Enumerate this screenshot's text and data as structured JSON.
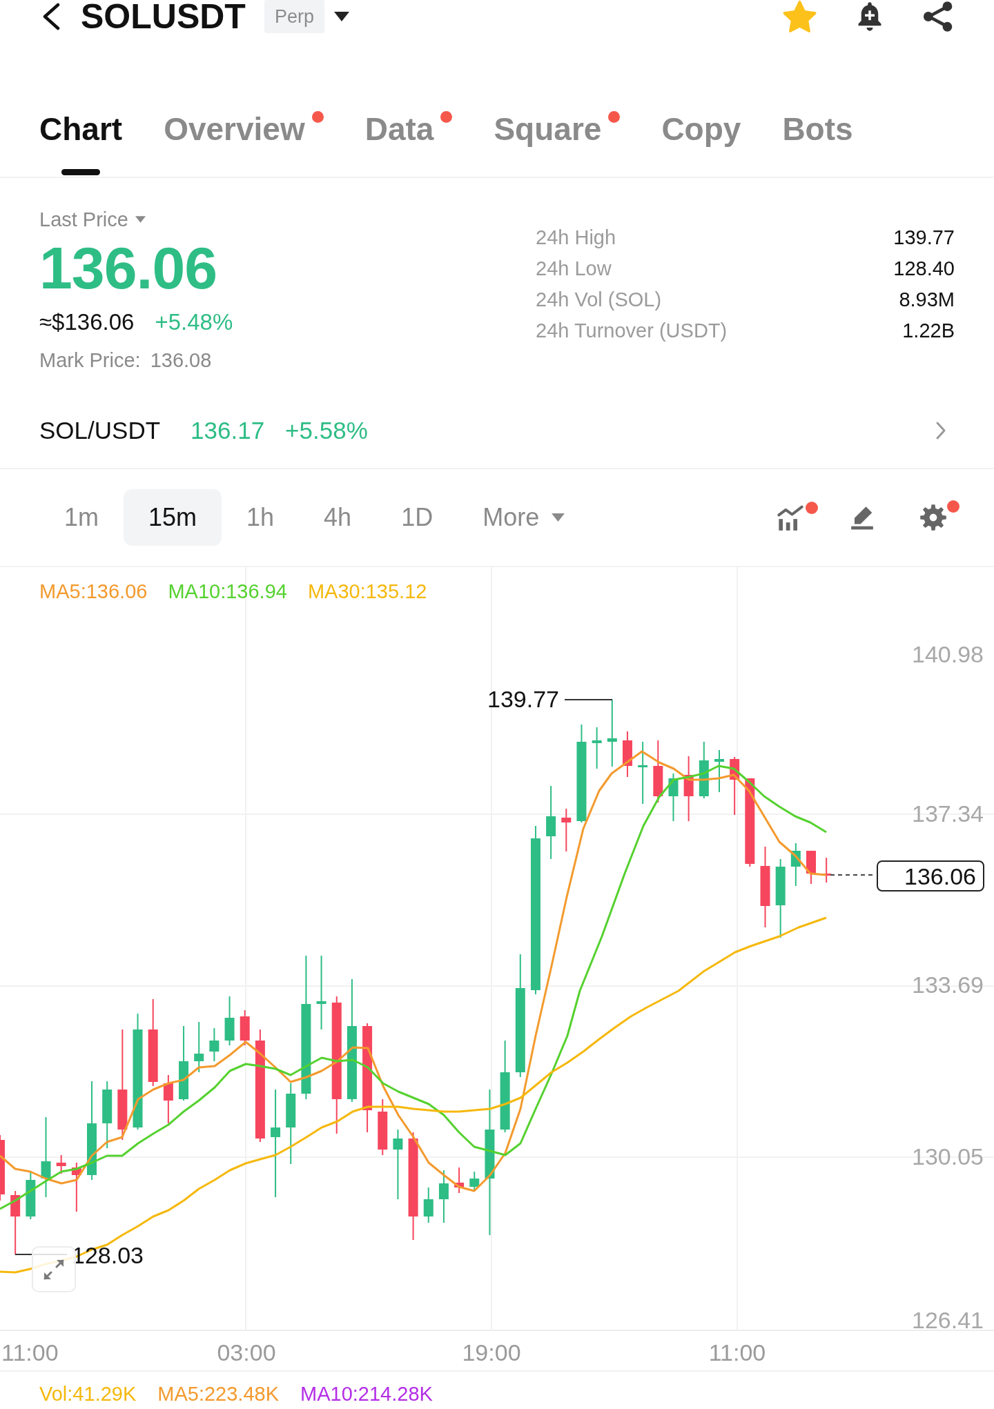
{
  "header": {
    "title": "SOLUSDT",
    "badge": "Perp",
    "favorite": true
  },
  "tabs": [
    {
      "label": "Chart",
      "selected": true,
      "dot": false
    },
    {
      "label": "Overview",
      "selected": false,
      "dot": true
    },
    {
      "label": "Data",
      "selected": false,
      "dot": true
    },
    {
      "label": "Square",
      "selected": false,
      "dot": true
    },
    {
      "label": "Copy",
      "selected": false,
      "dot": false
    },
    {
      "label": "Bots",
      "selected": false,
      "dot": false
    }
  ],
  "price": {
    "label": "Last Price",
    "last": "136.06",
    "usd": "≈$136.06",
    "change": "+5.48%",
    "mark_label": "Mark Price:",
    "mark_value": "136.08"
  },
  "stats": [
    {
      "label": "24h High",
      "value": "139.77"
    },
    {
      "label": "24h Low",
      "value": "128.40"
    },
    {
      "label": "24h Vol (SOL)",
      "value": "8.93M"
    },
    {
      "label": "24h Turnover (USDT)",
      "value": "1.22B"
    }
  ],
  "spot": {
    "pair": "SOL/USDT",
    "price": "136.17",
    "change": "+5.58%"
  },
  "intervals": [
    {
      "label": "1m",
      "selected": false,
      "kind": "interval"
    },
    {
      "label": "15m",
      "selected": true,
      "kind": "interval"
    },
    {
      "label": "1h",
      "selected": false,
      "kind": "interval"
    },
    {
      "label": "4h",
      "selected": false,
      "kind": "interval"
    },
    {
      "label": "1D",
      "selected": false,
      "kind": "interval"
    },
    {
      "label": "More",
      "selected": false,
      "kind": "dropdown"
    }
  ],
  "tools": [
    {
      "kind": "indicators",
      "dot": true
    },
    {
      "kind": "drawing",
      "dot": false
    },
    {
      "kind": "settings",
      "dot": true
    }
  ],
  "chart": {
    "ma_legend": [
      {
        "text": "MA5:136.06",
        "color": "#f39a2d"
      },
      {
        "text": "MA10:136.94",
        "color": "#55d12f"
      },
      {
        "text": "MA30:135.12",
        "color": "#f5b80c"
      }
    ],
    "y_axis": [
      "140.98",
      "137.34",
      "133.69",
      "130.05",
      "126.41"
    ],
    "x_axis": [
      "11:00",
      "03:00",
      "19:00",
      "11:00"
    ],
    "high_label": "139.77",
    "low_label": "128.03",
    "current_price": "136.06"
  },
  "volume": {
    "legend": [
      {
        "text": "Vol:41.29K",
        "color": "#f5b80c"
      },
      {
        "text": "MA5:223.48K",
        "color": "#f39a2d"
      },
      {
        "text": "MA10:214.28K",
        "color": "#b42ee6"
      }
    ]
  }
}
